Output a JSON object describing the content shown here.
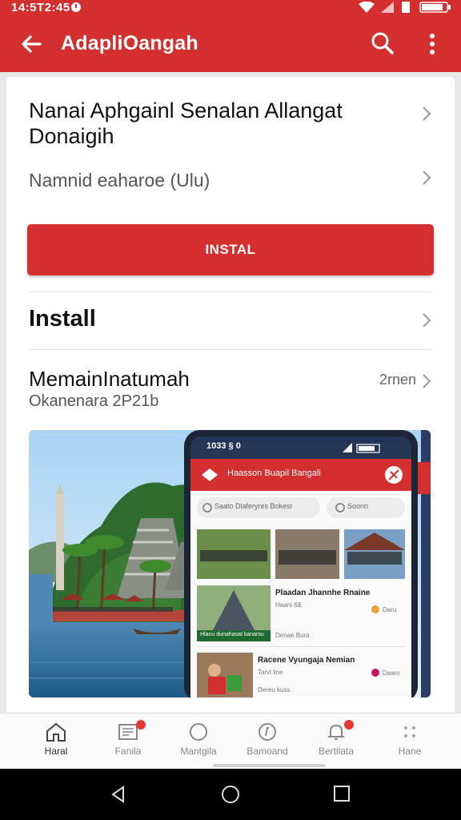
{
  "status_bar": {
    "time": "14:5T2:45"
  },
  "app_bar": {
    "title": "AdapliOangah",
    "back_icon": "arrow-back-icon",
    "search_icon": "search-icon",
    "more_icon": "more-vert-icon",
    "color": "#d32f2f"
  },
  "card": {
    "app_name": "Nanai Aphgainl Senalan Allangat Donaigih",
    "subtitle": "Namnid eaharoe (Ulu)",
    "install_button": "INSTAL",
    "install_row": "Install",
    "section": {
      "title": "MemainInatumah",
      "subtitle": "Okanenara 2P21b",
      "more": "2rnen"
    }
  },
  "preview": {
    "phone_time": "1033 § 0",
    "phone_title": "Haasson Buapil Bangali",
    "search_left": "Saato Dlaferyres Bokesr",
    "search_right": "Soonn",
    "list": [
      {
        "title": "Plaadan Jhannhe Rnaine",
        "meta": "Haani 6&",
        "tag": "Daru",
        "footer": "Denae Bura"
      },
      {
        "title": "Racene Vyungaja Nemian",
        "meta": "Tarvl line",
        "tag": "Daam",
        "footer": "Dereu kuss"
      }
    ],
    "banner": "Hlanu dunahasat kanarsu"
  },
  "bottom_nav": [
    {
      "label": "Haral",
      "icon": "home-icon",
      "active": true
    },
    {
      "label": "Fanila",
      "icon": "news-icon",
      "badge": true
    },
    {
      "label": "Mantgila",
      "icon": "circle-icon"
    },
    {
      "label": "Bamoand",
      "icon": "compass-icon"
    },
    {
      "label": "Bertilata",
      "icon": "bell-icon",
      "badge": true
    },
    {
      "label": "Hane",
      "icon": "grid-icon"
    }
  ],
  "system_nav": {
    "back": "back-triangle-icon",
    "home": "home-circle-icon",
    "recents": "recents-square-icon"
  }
}
